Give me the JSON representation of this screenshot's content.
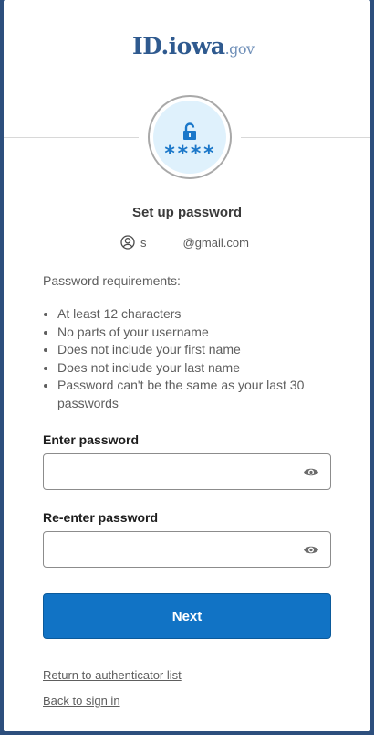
{
  "logo": {
    "main": "ID.iowa",
    "suffix": ".gov"
  },
  "header": {
    "title": "Set up password",
    "user_initial": "s",
    "user_email_domain": "@gmail.com",
    "badge_stars": "****"
  },
  "requirements": {
    "heading": "Password requirements:",
    "items": [
      "At least 12 characters",
      "No parts of your username",
      "Does not include your first name",
      "Does not include your last name",
      "Password can't be the same as your last 30 passwords"
    ]
  },
  "form": {
    "password_label": "Enter password",
    "password_value": "",
    "confirm_label": "Re-enter password",
    "confirm_value": "",
    "next_label": "Next"
  },
  "links": {
    "return_list": "Return to authenticator list",
    "back_sign_in": "Back to sign in"
  },
  "colors": {
    "primary_button": "#1173c5",
    "badge_fill": "#dff1fc",
    "icon_blue": "#1a77c9",
    "page_background": "#2d4f7d"
  },
  "icons": {
    "badge": "lock-open-icon",
    "user": "user-circle-icon",
    "show_password": "eye-icon"
  }
}
